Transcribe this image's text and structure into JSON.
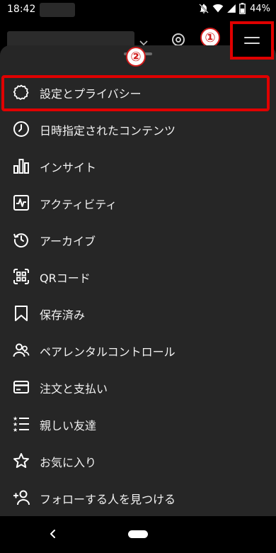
{
  "status_bar": {
    "time": "18:42",
    "battery": "44%",
    "icons": [
      "notifications-off-icon",
      "wifi-icon",
      "signal-icon",
      "battery-icon"
    ]
  },
  "header": {
    "annotation_1": "①",
    "annotation_2": "②",
    "icons": [
      "chevron-down-icon",
      "threads-icon",
      "hamburger-menu-icon"
    ]
  },
  "menu": {
    "items": [
      {
        "label": "設定とプライバシー",
        "icon": "settings-gear-icon"
      },
      {
        "label": "日時指定されたコンテンツ",
        "icon": "clock-icon"
      },
      {
        "label": "インサイト",
        "icon": "bar-chart-icon"
      },
      {
        "label": "アクティビティ",
        "icon": "activity-icon"
      },
      {
        "label": "アーカイブ",
        "icon": "archive-icon"
      },
      {
        "label": "QRコード",
        "icon": "qr-code-icon"
      },
      {
        "label": "保存済み",
        "icon": "bookmark-icon"
      },
      {
        "label": "ペアレンタルコントロール",
        "icon": "family-icon"
      },
      {
        "label": "注文と支払い",
        "icon": "credit-card-icon"
      },
      {
        "label": "親しい友達",
        "icon": "close-friends-list-icon"
      },
      {
        "label": "お気に入り",
        "icon": "star-icon"
      },
      {
        "label": "フォローする人を見つける",
        "icon": "add-person-icon"
      }
    ]
  },
  "colors": {
    "sheet_background": "#262626",
    "annotation_red": "#e00000"
  }
}
